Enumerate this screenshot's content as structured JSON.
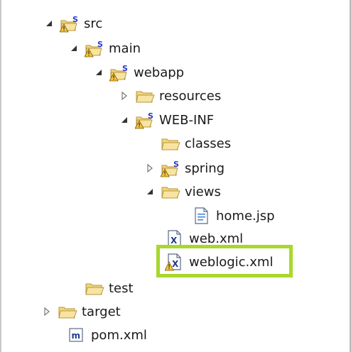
{
  "tree": {
    "items": [
      {
        "label": "src",
        "icon": "source-folder-warning-icon",
        "toggle": "expanded"
      },
      {
        "label": "main",
        "icon": "source-folder-warning-icon",
        "toggle": "expanded"
      },
      {
        "label": "webapp",
        "icon": "source-folder-warning-icon",
        "toggle": "expanded"
      },
      {
        "label": "resources",
        "icon": "folder-icon",
        "toggle": "collapsed"
      },
      {
        "label": "WEB-INF",
        "icon": "source-folder-warning-icon",
        "toggle": "expanded"
      },
      {
        "label": "classes",
        "icon": "folder-icon",
        "toggle": "none"
      },
      {
        "label": "spring",
        "icon": "source-folder-warning-icon",
        "toggle": "collapsed"
      },
      {
        "label": "views",
        "icon": "folder-icon",
        "toggle": "expanded"
      },
      {
        "label": "home.jsp",
        "icon": "jsp-file-icon",
        "toggle": "none"
      },
      {
        "label": "web.xml",
        "icon": "xml-file-icon",
        "toggle": "none"
      },
      {
        "label": "weblogic.xml",
        "icon": "xml-file-warning-icon",
        "toggle": "none",
        "highlighted": true
      },
      {
        "label": "test",
        "icon": "folder-icon",
        "toggle": "none"
      },
      {
        "label": "target",
        "icon": "folder-icon",
        "toggle": "collapsed"
      },
      {
        "label": "pom.xml",
        "icon": "maven-pom-icon",
        "toggle": "none"
      }
    ]
  },
  "colors": {
    "highlight_border": "#a8d82a",
    "folder": "#f2d67a",
    "source_badge": "#2a3ad0"
  }
}
